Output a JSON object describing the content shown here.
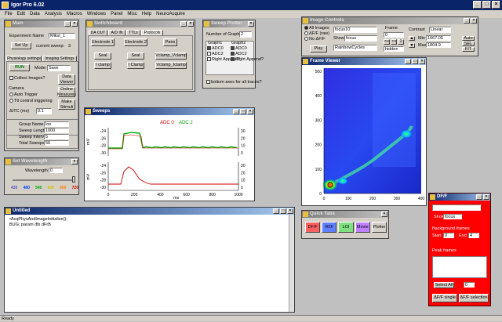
{
  "app": {
    "title": "Igor Pro 6.02",
    "status": "Ready"
  },
  "menu": [
    "File",
    "Edit",
    "Data",
    "Analysis",
    "Macros",
    "Windows",
    "Panel",
    "Misc",
    "Help",
    "NeuroAcquire"
  ],
  "main": {
    "title": "Main",
    "experiment_label": "Experiment Name",
    "experiment_value": "MiksI_1",
    "setup_label": "Set Up",
    "sweep_label": "current sweep:",
    "sweep_value": "3",
    "tabs": [
      "Physiology settings",
      "Imaging Settings"
    ],
    "run_label": "RUN",
    "mode_label": "Mode:",
    "mode_value": "Save",
    "collect_images": "Collect Images?",
    "data_viewer": "Data Viewer",
    "camera_label": "Camera",
    "auto_trigger": "Auto Trigger",
    "ttl_control": "Ttl control triggering",
    "online_measures": "Online Measures",
    "make_stimuli": "Make Stimuli",
    "delta_itc_label": "ΔITC (ms)",
    "delta_itc_value": "0.1",
    "group_name_label": "Group Name",
    "group_name_value": "loo",
    "sweep_length_label": "Sweep Length (ms)",
    "sweep_length_value": "1000",
    "sweep_interval_label": "Sweep Interval (s)",
    "sweep_interval_value": "5",
    "total_sweeps_label": "Total Sweeps",
    "total_sweeps_value": "56"
  },
  "switchboard": {
    "title": "Switchboard",
    "tabs": [
      "DA OUT",
      "A/D IN",
      "TTLs",
      "Protocols"
    ],
    "electrode1": "Electrode 1",
    "electrode2": "Electrode 2",
    "pairs": "Pairs",
    "seal1": "Seal",
    "seal2": "Seal",
    "vclamp_vclamp": "Vclamp_Vclamp",
    "iclamp1": "I clamp",
    "iclamp2": "I Clamp",
    "vclamp_iclamp": "Vclamp_Iclamp"
  },
  "sweep_plotter": {
    "title": "Sweep Plotter",
    "num_graphs_label": "Number of Graphs:",
    "num_graphs_value": "2",
    "graph1_header": "Graph1",
    "graph2_header": "Graph2",
    "graph1_items": [
      "ADC0",
      "ADC2",
      "Right Append?"
    ],
    "graph2_items": [
      "ADC0",
      "ADC2",
      "Right Append?"
    ],
    "bottom_axes": "bottom axes for all traces?"
  },
  "sweeps": {
    "title": "Sweeps",
    "legend_adc0": "ADC 0",
    "legend_adc2": "ADC 2",
    "colors": {
      "adc0": "#cc0000",
      "adc2": "#00aa00"
    },
    "y_top_ticks": [
      "-24",
      "-26",
      "-28",
      "-30"
    ],
    "y_bottom_ticks": [
      "-24",
      "-26",
      "-28",
      "-30"
    ],
    "y_right_top_ticks": [
      "30",
      "20",
      "10",
      "0"
    ],
    "y_right_bottom_ticks": [
      "30",
      "20",
      "10",
      "0"
    ],
    "x_ticks": [
      "0",
      "200",
      "400",
      "600",
      "800",
      "1000"
    ],
    "ylabel": "mV",
    "xlabel": "ms"
  },
  "wavelength": {
    "title": "Set Wavelength",
    "label": "Wavelength",
    "value": "0",
    "ticks": [
      "420",
      "480",
      "540",
      "600",
      "660",
      "720"
    ],
    "tick_colors": [
      "#6050c0",
      "#0040ff",
      "#00b000",
      "#d0c000",
      "#ff8000",
      "#d00000"
    ]
  },
  "untitled": {
    "title": "Untitled",
    "lines": [
      "•AcqPhysAndImageInitialize();",
      "  BUG: param dfs dFrB"
    ]
  },
  "image_controls": {
    "title": "Image Controls",
    "radios": [
      "All Images",
      "ΔF/F (raw)",
      "No ΔF/F"
    ],
    "play": "Play",
    "wave_select": "focus10",
    "show_label": "Show:",
    "show_value": "focus",
    "colormap": "RainbowCycles",
    "frame_label": "Frame",
    "frame_value": "0",
    "nav_buttons": [
      "<<",
      ">>",
      "1"
    ],
    "hidden_label": "hidden",
    "contrast_label": "Contrast",
    "contrast_value": "Linear",
    "min_label": "Min",
    "min_value": "1667.05",
    "max_label": "Max",
    "max_value": "1804.9",
    "auto": "Auto",
    "sel": "SEL",
    "fit": "FIT"
  },
  "frame_viewer": {
    "title": "Frame Viewer",
    "y_ticks": [
      "500",
      "400",
      "300",
      "200",
      "100",
      "0"
    ],
    "x_ticks": [
      "0",
      "100",
      "200",
      "300",
      "400"
    ]
  },
  "quick_tabs": {
    "title": "Quick Tabs",
    "buttons": [
      "DF/F",
      "ROI",
      "LOI",
      "Movie",
      "Plotter"
    ],
    "colors": [
      "#ff6060",
      "#6080ff",
      "#80e080",
      "#c080ff",
      "#d4d0c8"
    ]
  },
  "dff": {
    "title": "DF/F",
    "show_label": "Show",
    "show_value": "focus",
    "bg_label": "Background frames",
    "start_label": "Start",
    "start_value": "0",
    "end_label": "End",
    "end_value": "4",
    "peak_label": "Peak frames",
    "select_all": "Select All",
    "count_value": "0",
    "single": "ΔF/F single",
    "selection": "ΔF/F selection",
    "accent": "#ff0000"
  }
}
